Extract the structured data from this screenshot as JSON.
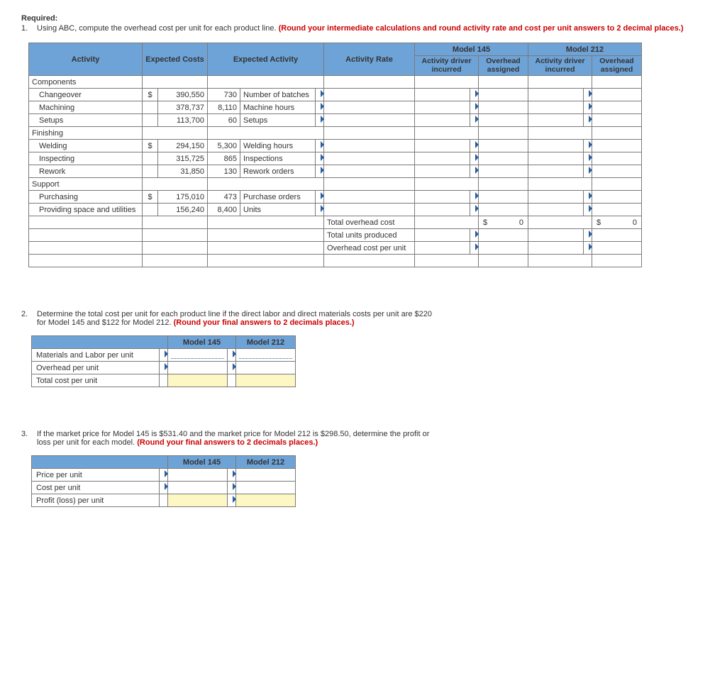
{
  "required_label": "Required:",
  "q1": {
    "num": "1.",
    "text_a": "Using ABC, compute the overhead cost per unit for each product line. ",
    "text_red": "(Round your intermediate calculations and round activity rate and cost per unit answers to 2 decimal places.)"
  },
  "t1": {
    "headers": {
      "activity": "Activity",
      "exp_costs": "Expected Costs",
      "exp_activity": "Expected Activity",
      "rate": "Activity Rate",
      "m145": "Model 145",
      "m212": "Model 212",
      "driver": "Activity driver incurred",
      "assigned": "Overhead assigned"
    },
    "rows": [
      {
        "type": "group",
        "label": "Components"
      },
      {
        "type": "item",
        "label": "Changeover",
        "cur": "$",
        "cost": "390,550",
        "qty": "730",
        "driver": "Number of batches"
      },
      {
        "type": "item",
        "label": "Machining",
        "cur": "",
        "cost": "378,737",
        "qty": "8,110",
        "driver": "Machine hours"
      },
      {
        "type": "item",
        "label": "Setups",
        "cur": "",
        "cost": "113,700",
        "qty": "60",
        "driver": "Setups"
      },
      {
        "type": "group",
        "label": "Finishing"
      },
      {
        "type": "item",
        "label": "Welding",
        "cur": "$",
        "cost": "294,150",
        "qty": "5,300",
        "driver": "Welding hours"
      },
      {
        "type": "item",
        "label": "Inspecting",
        "cur": "",
        "cost": "315,725",
        "qty": "865",
        "driver": "Inspections"
      },
      {
        "type": "item",
        "label": "Rework",
        "cur": "",
        "cost": "31,850",
        "qty": "130",
        "driver": "Rework orders"
      },
      {
        "type": "group",
        "label": "Support"
      },
      {
        "type": "item",
        "label": "Purchasing",
        "cur": "$",
        "cost": "175,010",
        "qty": "473",
        "driver": "Purchase orders"
      },
      {
        "type": "item",
        "label": "Providing space and utilities",
        "cur": "",
        "cost": "156,240",
        "qty": "8,400",
        "driver": "Units"
      }
    ],
    "totals": {
      "toc": "Total overhead cost",
      "tup": "Total units produced",
      "ocpu": "Overhead cost per unit",
      "cur": "$",
      "zero": "0"
    }
  },
  "q2": {
    "num": "2.",
    "text_a": "Determine the total cost per unit for each product line if the direct labor and direct materials costs per unit are $220 for Model 145 and $122 for Model 212. ",
    "text_red": "(Round your final answers to 2 decimals places.)"
  },
  "t2": {
    "h1": "Model 145",
    "h2": "Model 212",
    "r1": "Materials and Labor per unit",
    "r2": "Overhead per unit",
    "r3": "Total cost per unit"
  },
  "q3": {
    "num": "3.",
    "text_a": "If the market price for Model 145 is $531.40 and the market price for Model 212 is $298.50, determine the profit or loss per unit for each model. ",
    "text_red": "(Round your final answers to 2 decimals places.)"
  },
  "t3": {
    "h1": "Model 145",
    "h2": "Model 212",
    "r1": "Price per unit",
    "r2": "Cost per unit",
    "r3": "Profit (loss) per unit"
  }
}
